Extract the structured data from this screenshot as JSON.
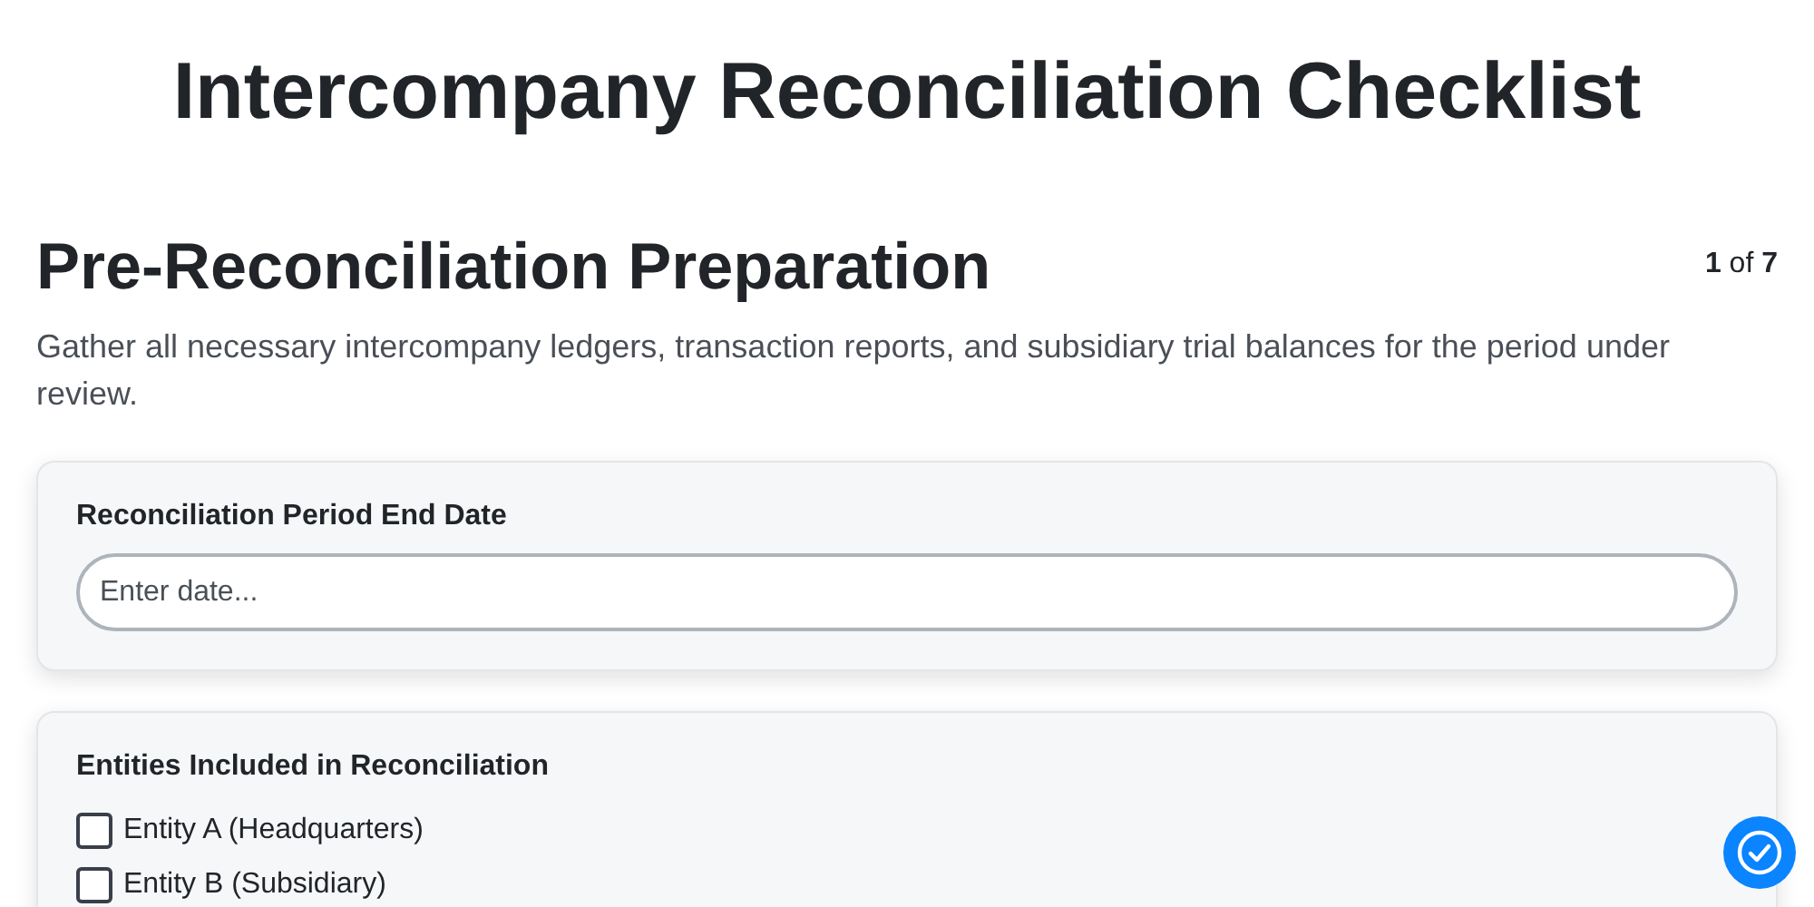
{
  "title": "Intercompany Reconciliation Checklist",
  "step": {
    "title": "Pre-Reconciliation Preparation",
    "current": "1",
    "of": "of",
    "total": "7",
    "description": "Gather all necessary intercompany ledgers, transaction reports, and subsidiary trial balances for the period under review."
  },
  "fields": [
    {
      "kind": "text",
      "label": "Reconciliation Period End Date",
      "placeholder": "Enter date..."
    },
    {
      "kind": "checklist",
      "label": "Entities Included in Reconciliation",
      "options": [
        {
          "label": "Entity A (Headquarters)",
          "checked": false
        },
        {
          "label": "Entity B (Subsidiary)",
          "checked": false
        }
      ]
    }
  ]
}
